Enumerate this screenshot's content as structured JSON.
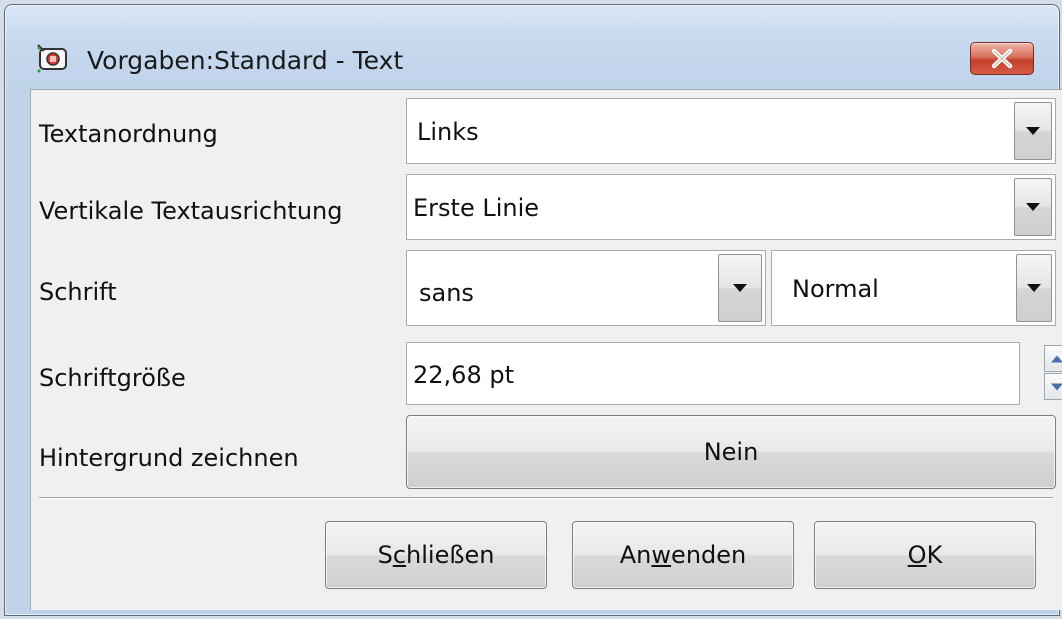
{
  "window": {
    "title": "Vorgaben:Standard - Text",
    "app_icon": "draw-app-icon",
    "close_icon": "close-icon"
  },
  "form": {
    "text_alignment": {
      "label": "Textanordnung",
      "value": "Links"
    },
    "vertical_alignment": {
      "label": "Vertikale Textausrichtung",
      "value": "Erste Linie"
    },
    "font": {
      "label": "Schrift",
      "family_value": "sans",
      "style_value": "Normal"
    },
    "font_size": {
      "label": "Schriftgröße",
      "value": "22,68 pt"
    },
    "background": {
      "label": "Hintergrund zeichnen",
      "value": "Nein"
    }
  },
  "buttons": {
    "close_pre": "S",
    "close_mn": "c",
    "close_post": "hließen",
    "apply_pre": "An",
    "apply_mn": "w",
    "apply_post": "enden",
    "ok_mn": "O",
    "ok_post": "K"
  }
}
